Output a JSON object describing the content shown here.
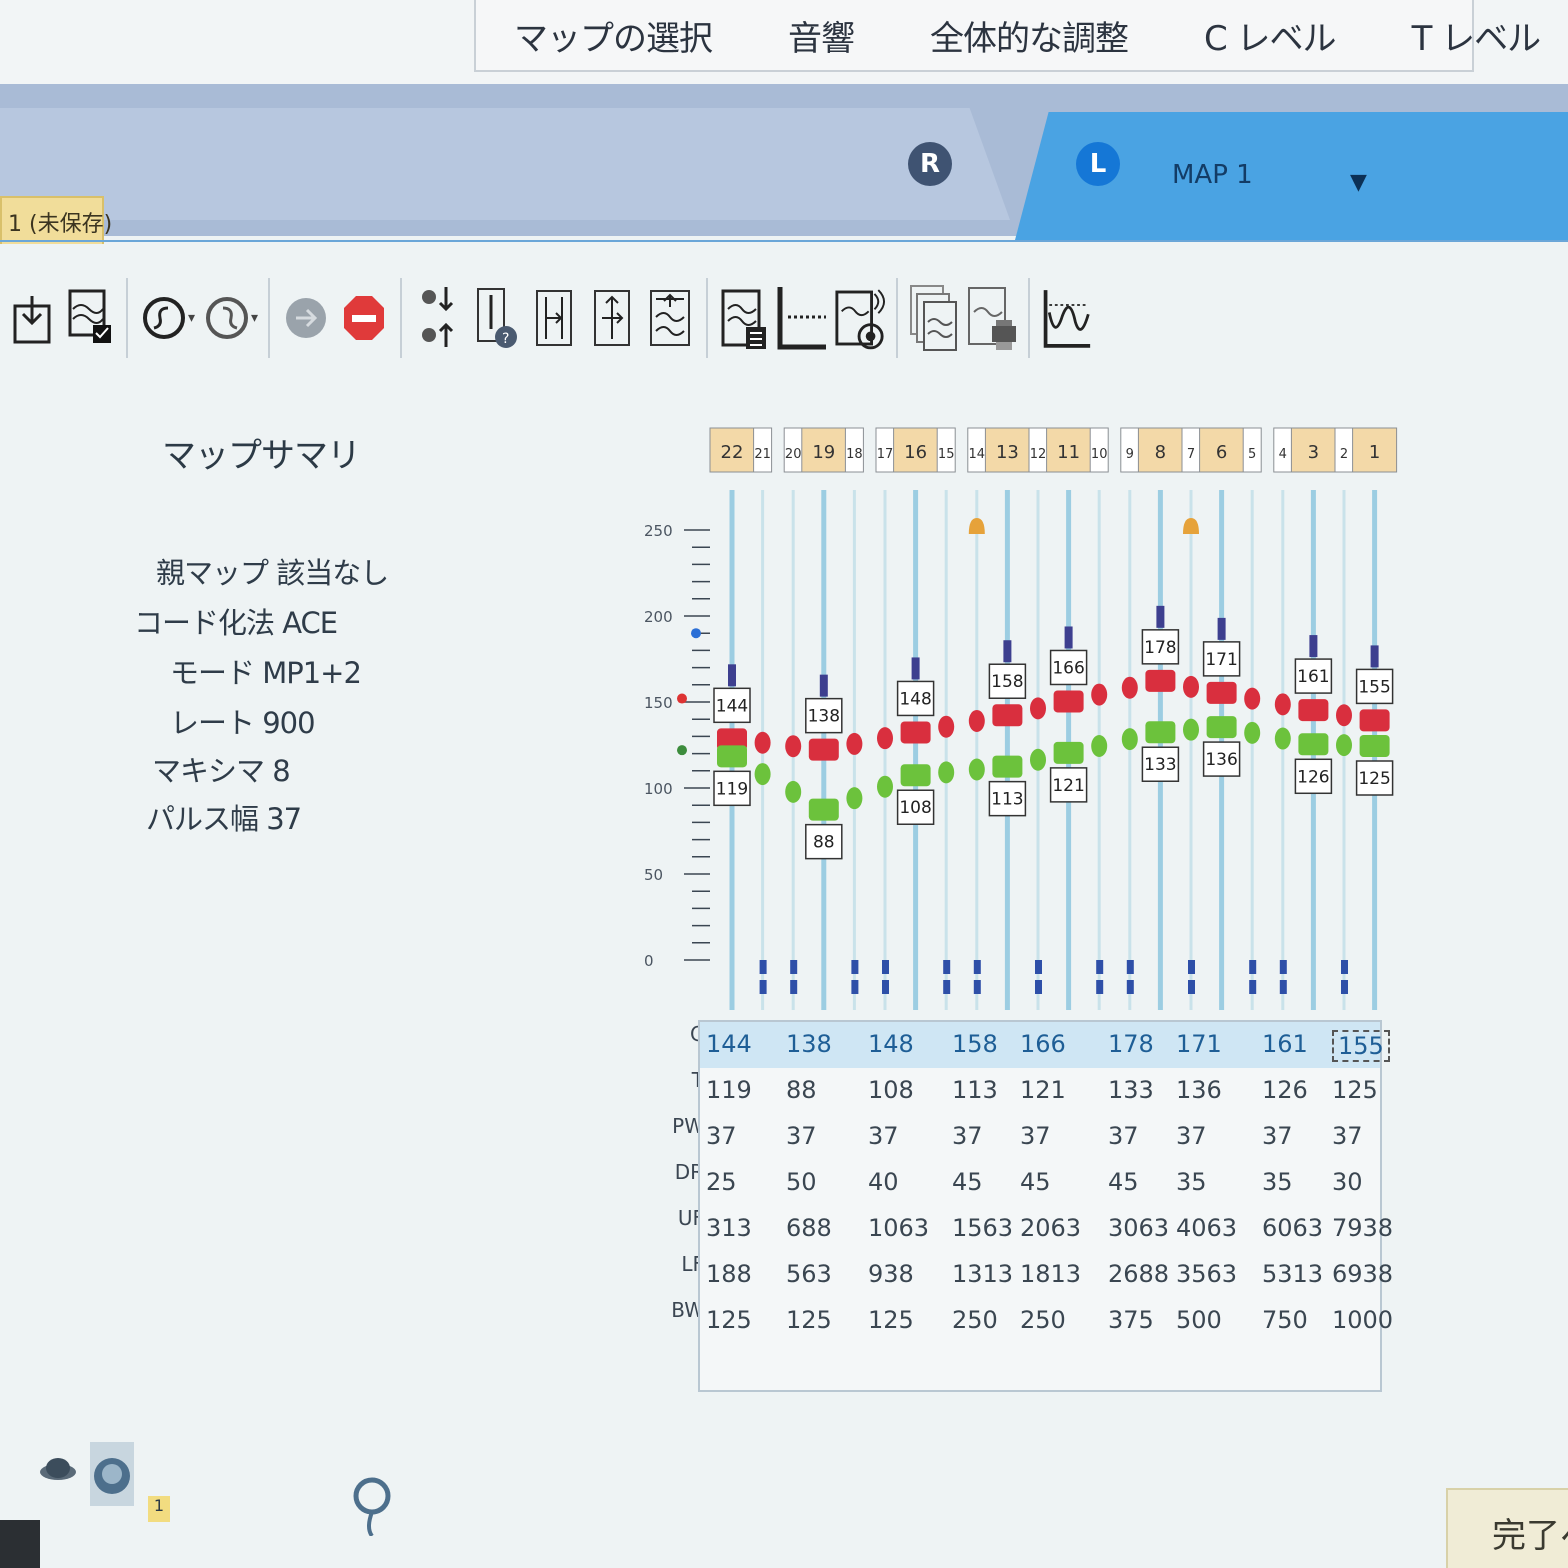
{
  "top_menu": {
    "items": [
      "マップの選択",
      "音響",
      "全体的な調整",
      "C レベル",
      "T レベル"
    ],
    "settings_icon": "wrench-icon"
  },
  "ear_header": {
    "right_badge": "R",
    "left_badge": "L",
    "map_name": "MAP 1",
    "dropdown_icon": "triangle-down-icon"
  },
  "session_tab": {
    "label": "1 (未保存)"
  },
  "toolbar": {
    "icons": [
      "download-icon",
      "map-check-icon",
      "undo-icon",
      "redo-icon",
      "forward-icon",
      "stop-icon",
      "swap-levels-icon",
      "level-info-icon",
      "global-shift-icon",
      "range-adjust-icon",
      "expand-compress-icon",
      "map-clipboard-icon",
      "threshold-line-icon",
      "live-sound-icon",
      "copy-maps-icon",
      "print-map-icon",
      "waveform-icon"
    ]
  },
  "summary": {
    "title": "マップサマリ",
    "rows": [
      "親マップ 該当なし",
      "コード化法 ACE",
      "モード MP1+2",
      "レート 900",
      "マキシマ 8",
      "パルス幅 37"
    ]
  },
  "chart_data": {
    "type": "electrode-levels",
    "y_ticks": [
      "250",
      "200",
      "150",
      "100",
      "50",
      "0"
    ],
    "ylim": [
      0,
      250
    ],
    "electrodes": [
      "22",
      "21",
      "20",
      "19",
      "18",
      "17",
      "16",
      "15",
      "14",
      "13",
      "12",
      "11",
      "10",
      "9",
      "8",
      "7",
      "6",
      "5",
      "4",
      "3",
      "2",
      "1"
    ],
    "active_electrodes": [
      "22",
      "19",
      "16",
      "13",
      "11",
      "8",
      "6",
      "3",
      "1"
    ],
    "c_levels": [
      144,
      138,
      148,
      158,
      166,
      178,
      171,
      161,
      155
    ],
    "t_levels": [
      119,
      88,
      108,
      113,
      121,
      133,
      136,
      126,
      125
    ],
    "alert_electrodes": [
      "14",
      "7"
    ],
    "colors": {
      "c_level": "#d92f3e",
      "t_level": "#6cc23c",
      "active_header": "#f3d9a8",
      "track": "#b8dbe8"
    }
  },
  "table": {
    "row_labels": [
      "C",
      "T",
      "PW",
      "DR",
      "UF",
      "LF",
      "BW"
    ],
    "columns": [
      [
        "144",
        "119",
        "37",
        "25",
        "313",
        "188",
        "125"
      ],
      [
        "138",
        "88",
        "37",
        "50",
        "688",
        "563",
        "125"
      ],
      [
        "148",
        "108",
        "37",
        "40",
        "1063",
        "938",
        "125"
      ],
      [
        "158",
        "113",
        "37",
        "45",
        "1563",
        "1313",
        "250"
      ],
      [
        "166",
        "121",
        "37",
        "45",
        "2063",
        "1813",
        "250"
      ],
      [
        "178",
        "133",
        "37",
        "45",
        "3063",
        "2688",
        "375"
      ],
      [
        "171",
        "136",
        "37",
        "35",
        "4063",
        "3563",
        "500"
      ],
      [
        "161",
        "126",
        "37",
        "35",
        "6063",
        "5313",
        "750"
      ],
      [
        "155",
        "125",
        "37",
        "30",
        "7938",
        "6938",
        "1000"
      ]
    ]
  },
  "bottom": {
    "badge": "1",
    "finish_label": "完了へ"
  }
}
